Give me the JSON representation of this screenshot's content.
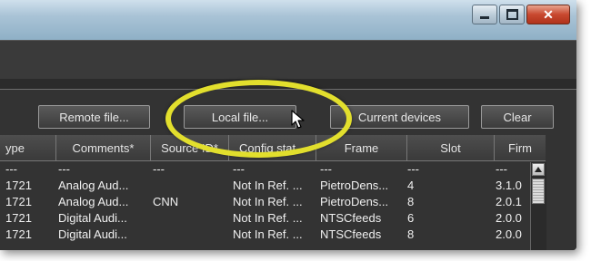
{
  "toolbar": {
    "buttons": [
      {
        "label": "Remote file..."
      },
      {
        "label": "Local file..."
      },
      {
        "label": "Current devices"
      },
      {
        "label": "Clear"
      }
    ]
  },
  "table": {
    "columns": [
      "ype",
      "Comments*",
      "Source ID*",
      "Config stat...",
      "Frame",
      "Slot",
      "Firm"
    ],
    "rows": [
      [
        "---",
        "---",
        "---",
        "---",
        "---",
        "---",
        "---"
      ],
      [
        "1721",
        "Analog Aud...",
        "",
        "Not In Ref. ...",
        "PietroDens...",
        "4",
        "3.1.0"
      ],
      [
        "1721",
        "Analog Aud...",
        "CNN",
        "Not In Ref. ...",
        "PietroDens...",
        "8",
        "2.0.1"
      ],
      [
        "1721",
        "Digital Audi...",
        "",
        "Not In Ref. ...",
        "NTSCfeeds",
        "6",
        "2.0.0"
      ],
      [
        "1721",
        "Digital Audi...",
        "",
        "Not In Ref. ...",
        "NTSCfeeds",
        "8",
        "2.0.0"
      ]
    ]
  },
  "highlight_color": "#e2df2d",
  "icons": [
    "minimize-icon",
    "maximize-icon",
    "close-icon",
    "mouse-pointer-icon",
    "scroll-up-icon"
  ]
}
